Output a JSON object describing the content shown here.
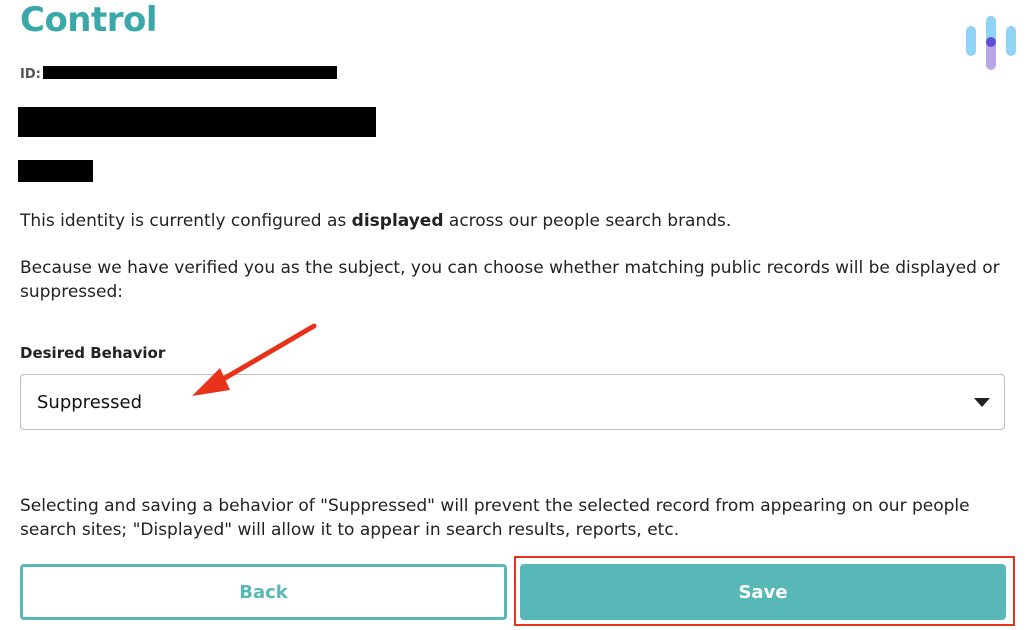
{
  "header": {
    "title": "Control",
    "id_label": "ID:"
  },
  "paragraphs": {
    "status_prefix": "This identity is currently configured as ",
    "status_value": "displayed",
    "status_suffix": " across our people search brands.",
    "choice": "Because we have verified you as the subject, you can choose whether matching public records will be displayed or suppressed:",
    "explanation": "Selecting and saving a behavior of \"Suppressed\" will prevent the selected record from appearing on our people search sites; \"Displayed\" will allow it to appear in search results, reports, etc."
  },
  "form": {
    "behavior_label": "Desired Behavior",
    "behavior_value": "Suppressed"
  },
  "buttons": {
    "back": "Back",
    "save": "Save"
  },
  "colors": {
    "brand": "#3aa8a8",
    "button": "#58b8b8",
    "annotation": "#e8331a"
  },
  "icons": {
    "logo": "brand-logo-icon",
    "dropdown": "caret-down-icon",
    "annotation": "red-arrow-icon"
  }
}
